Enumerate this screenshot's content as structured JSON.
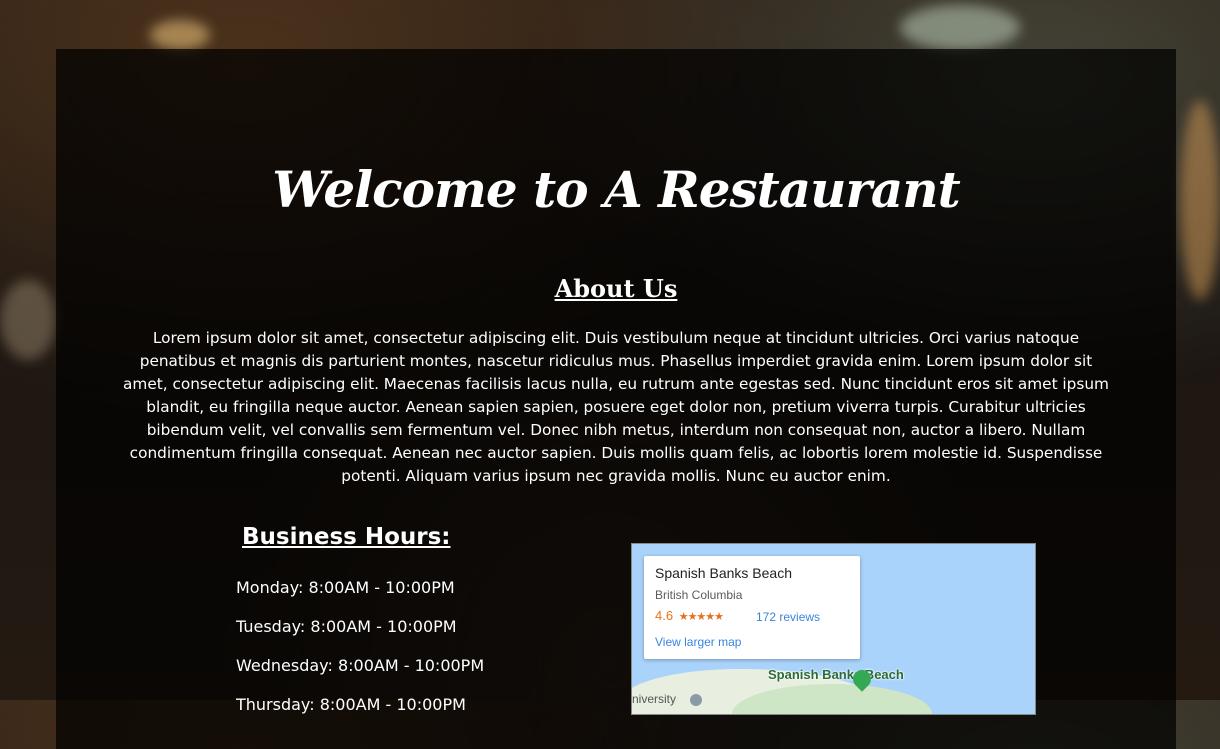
{
  "header": {
    "title": "Welcome to A Restaurant"
  },
  "about": {
    "heading": "About Us",
    "body": "Lorem ipsum dolor sit amet, consectetur adipiscing elit. Duis vestibulum neque at tincidunt ultricies. Orci varius natoque penatibus et magnis dis parturient montes, nascetur ridiculus mus. Phasellus imperdiet gravida enim. Lorem ipsum dolor sit amet, consectetur adipiscing elit. Maecenas facilisis lacus nulla, eu rutrum ante egestas sed. Nunc tincidunt eros sit amet ipsum blandit, eu fringilla neque auctor. Aenean sapien sapien, posuere eget dolor non, pretium viverra turpis. Curabitur ultricies bibendum velit, vel convallis sem fermentum vel. Donec nibh metus, interdum non consequat non, auctor a libero. Nullam condimentum fringilla consequat. Aenean nec auctor sapien. Duis mollis quam felis, ac lobortis lorem molestie id. Suspendisse potenti. Aliquam varius ipsum nec gravida mollis. Nunc eu auctor enim."
  },
  "hours": {
    "heading": "Business Hours:",
    "items": [
      "Monday: 8:00AM - 10:00PM",
      "Tuesday: 8:00AM - 10:00PM",
      "Wednesday: 8:00AM - 10:00PM",
      "Thursday: 8:00AM - 10:00PM"
    ]
  },
  "map": {
    "place_name": "Spanish Banks Beach",
    "region": "British Columbia",
    "rating": "4.6",
    "stars": "★★★★★",
    "reviews": "172 reviews",
    "larger_map_link": "View larger map",
    "pin_label": "Spanish Banks Beach",
    "nearby_label": "niversity",
    "water_color": "#aad3fb",
    "pin_color": "#34a853",
    "pin_icon": "map-marker-icon"
  }
}
